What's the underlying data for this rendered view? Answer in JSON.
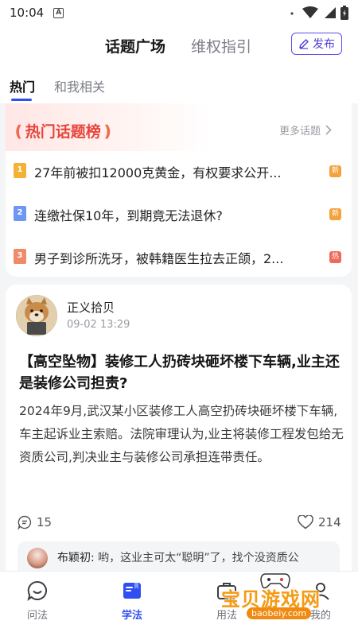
{
  "status_bar": {
    "time": "10:04",
    "a_badge": "A"
  },
  "header": {
    "tabs": [
      "话题广场",
      "维权指引"
    ],
    "publish_label": "发布"
  },
  "subtabs": [
    "热门",
    "和我相关"
  ],
  "hot_topics": {
    "title": "热门话题榜",
    "more_label": "更多话题",
    "items": [
      {
        "rank": "1",
        "text": "27年前被扣12000克黄金，有权要求公开...",
        "tag": "新",
        "tag_color": "#f5a23c",
        "rank_color": "#f5b136"
      },
      {
        "rank": "2",
        "text": "连缴社保10年，到期竟无法退休?",
        "tag": "新",
        "tag_color": "#f5a23c",
        "rank_color": "#6d97f2"
      },
      {
        "rank": "3",
        "text": "男子到诊所洗牙，被韩籍医生拉去正颌，2...",
        "tag": "热",
        "tag_color": "#ef6a5a",
        "rank_color": "#f08a6a"
      }
    ]
  },
  "post": {
    "author": "正义拾贝",
    "time": "09-02 13:29",
    "title": "【高空坠物】装修工人扔砖块砸坏楼下车辆,业主还是装修公司担责?",
    "body": "2024年9月,武汉某小区装修工人高空扔砖块砸坏楼下车辆,车主起诉业主索赔。法院审理认为,业主将装修工程发包给无资质公司,判决业主与装修公司承担连带责任。",
    "comments": "15",
    "likes": "214",
    "preview_name": "布颖初:",
    "preview_text": " 哟，这业主可太“聪明”了，找个没资质公"
  },
  "bottom_nav": [
    {
      "label": "问法",
      "icon": "chat-bubble-icon",
      "active": false
    },
    {
      "label": "学法",
      "icon": "book-icon",
      "active": true
    },
    {
      "label": "用法",
      "icon": "toolbox-icon",
      "active": false
    },
    {
      "label": "我的",
      "icon": "user-icon",
      "active": false
    }
  ],
  "watermark": {
    "text": "宝贝游戏网",
    "url": "baobeiy.com"
  },
  "colors": {
    "accent": "#2f4ff0",
    "publish": "#5b4ee6",
    "hot_red": "#e8453c"
  }
}
